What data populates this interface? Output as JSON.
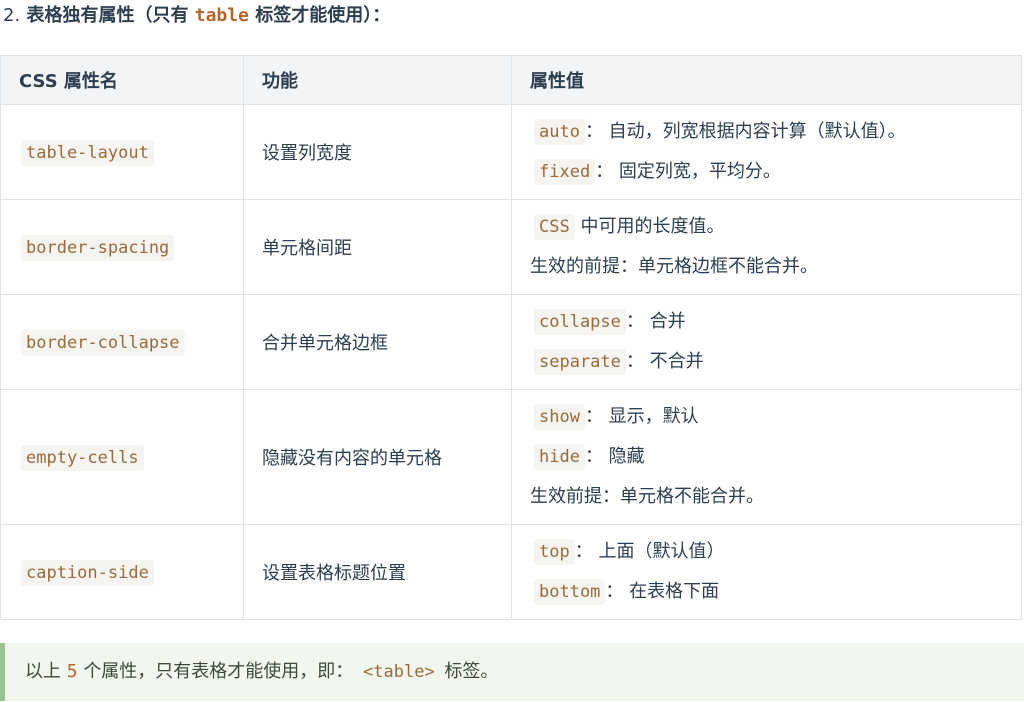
{
  "heading": {
    "number": "2.",
    "before": "表格独有属性（只有",
    "code": "table",
    "after": "标签才能使用）："
  },
  "table": {
    "headers": [
      "CSS 属性名",
      "功能",
      "属性值"
    ],
    "rows": [
      {
        "name": "table-layout",
        "func": "设置列宽度",
        "values": [
          {
            "code": "auto",
            "text": "： 自动，列宽根据内容计算（默认值）。"
          },
          {
            "code": "fixed",
            "text": "： 固定列宽，平均分。"
          }
        ]
      },
      {
        "name": "border-spacing",
        "func": "单元格间距",
        "values": [
          {
            "code": "CSS",
            "text": "中可用的长度值。"
          },
          {
            "code": "",
            "text": "生效的前提：单元格边框不能合并。"
          }
        ]
      },
      {
        "name": "border-collapse",
        "func": "合并单元格边框",
        "values": [
          {
            "code": "collapse",
            "text": "： 合并"
          },
          {
            "code": "separate",
            "text": "： 不合并"
          }
        ]
      },
      {
        "name": "empty-cells",
        "func": "隐藏没有内容的单元格",
        "values": [
          {
            "code": "show",
            "text": "： 显示，默认"
          },
          {
            "code": "hide",
            "text": "： 隐藏"
          },
          {
            "code": "",
            "text": "生效前提：单元格不能合并。"
          }
        ]
      },
      {
        "name": "caption-side",
        "func": "设置表格标题位置",
        "values": [
          {
            "code": "top",
            "text": "： 上面（默认值）"
          },
          {
            "code": "bottom",
            "text": "： 在表格下面"
          }
        ]
      }
    ]
  },
  "tip": {
    "before": "以上",
    "count": "5",
    "middle": "个属性，只有表格才能使用，即：",
    "code": "<table>",
    "after": "标签。"
  }
}
